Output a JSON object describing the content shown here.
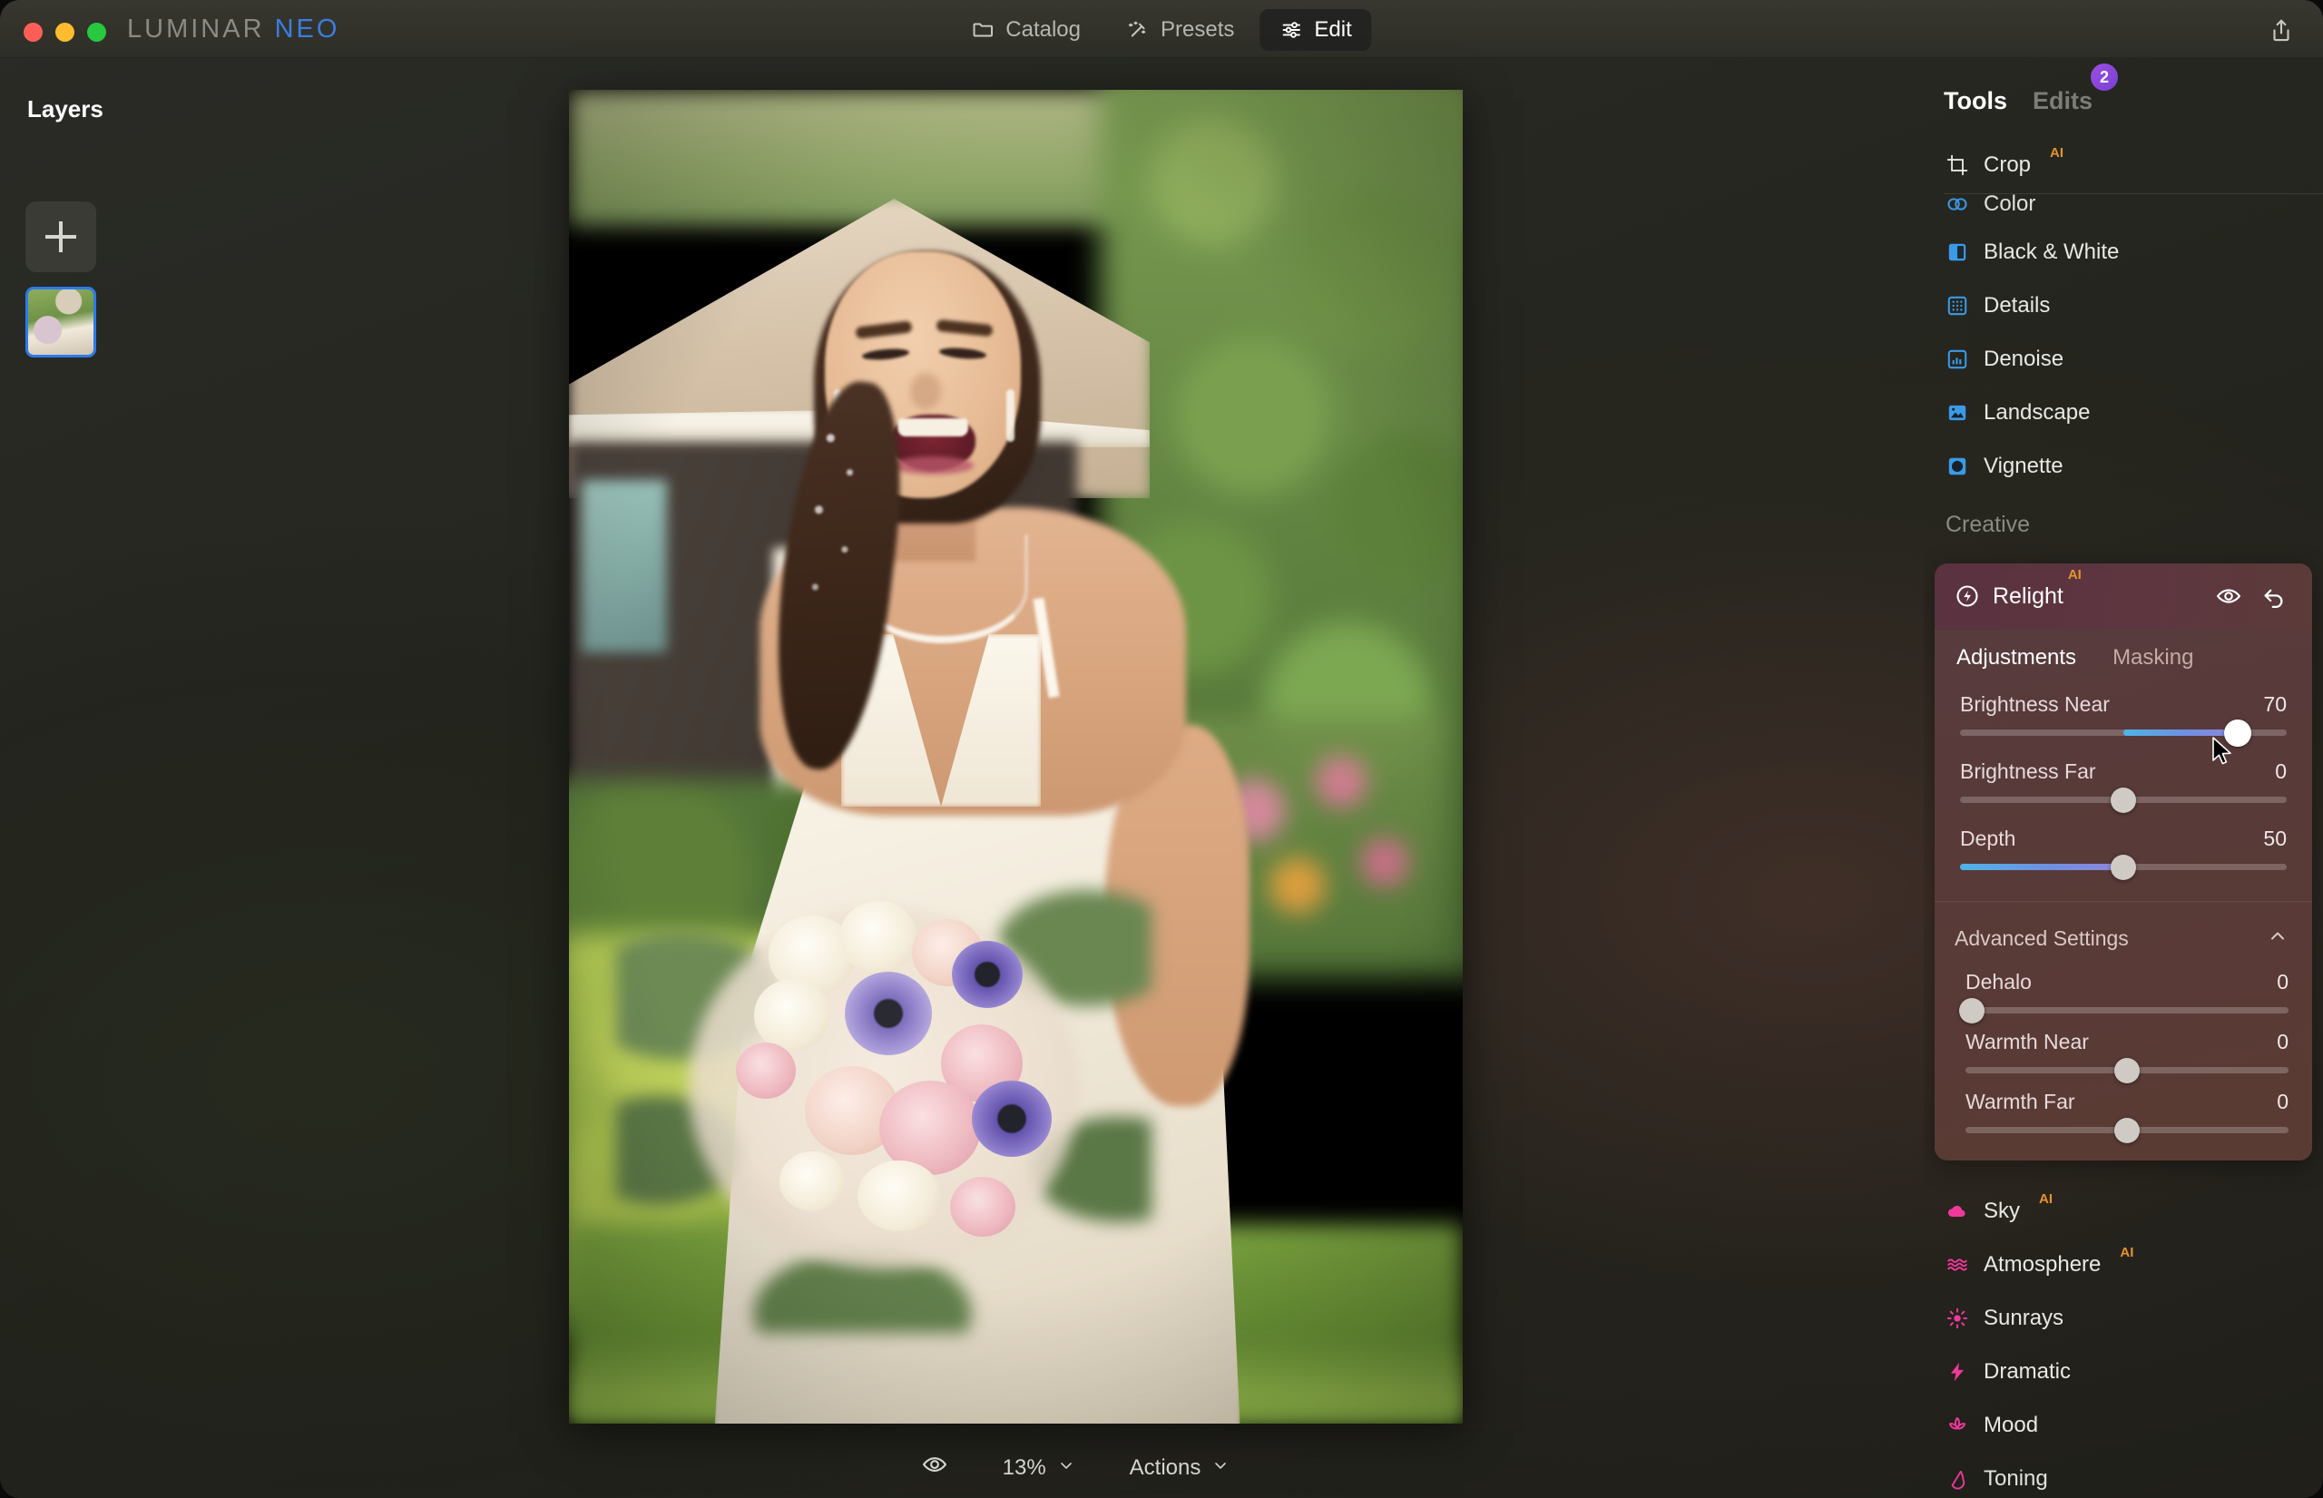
{
  "window": {
    "brand_main": "LUMINAR",
    "brand_accent": "NEO",
    "traffic_lights": [
      "close",
      "minimize",
      "maximize"
    ]
  },
  "topbar": {
    "modes": [
      {
        "label": "Catalog",
        "icon": "folder-icon",
        "active": false
      },
      {
        "label": "Presets",
        "icon": "magic-wand-icon",
        "active": false
      },
      {
        "label": "Edit",
        "icon": "sliders-icon",
        "active": true
      }
    ],
    "export_icon": "share-export-icon"
  },
  "layers": {
    "title": "Layers",
    "add_button_icon": "plus-icon",
    "thumbnail_selected": true,
    "selection_color": "#2b7bea"
  },
  "canvas": {
    "zoom_level": "13%",
    "actions_label": "Actions",
    "preview_icon": "eye-icon",
    "zoom_chevron": "chevron-down-icon",
    "actions_chevron": "chevron-down-icon"
  },
  "tools_panel": {
    "tabs": [
      {
        "label": "Tools",
        "active": true,
        "badge": null
      },
      {
        "label": "Edits",
        "active": false,
        "badge": "2"
      }
    ],
    "essentials": [
      {
        "label": "Crop",
        "icon": "crop-icon",
        "ai": "AI",
        "color": "#e9e9e4"
      }
    ],
    "essentials_scrolled": [
      {
        "label": "Color",
        "icon": "color-icon",
        "ai": null,
        "color": "#3b9ae8"
      },
      {
        "label": "Black & White",
        "icon": "bw-icon",
        "ai": null,
        "color": "#3b9ae8"
      },
      {
        "label": "Details",
        "icon": "details-icon",
        "ai": null,
        "color": "#3b9ae8"
      },
      {
        "label": "Denoise",
        "icon": "denoise-icon",
        "ai": null,
        "color": "#3b9ae8"
      },
      {
        "label": "Landscape",
        "icon": "landscape-icon",
        "ai": null,
        "color": "#3b9ae8"
      },
      {
        "label": "Vignette",
        "icon": "vignette-icon",
        "ai": null,
        "color": "#3b9ae8"
      }
    ],
    "creative_section_label": "Creative",
    "creative": [
      {
        "label": "Sky",
        "icon": "cloud-icon",
        "ai": "AI",
        "color": "#f0399b"
      },
      {
        "label": "Atmosphere",
        "icon": "waves-icon",
        "ai": "AI",
        "color": "#f0399b"
      },
      {
        "label": "Sunrays",
        "icon": "sun-icon",
        "ai": null,
        "color": "#f0399b"
      },
      {
        "label": "Dramatic",
        "icon": "bolt-icon",
        "ai": null,
        "color": "#f0399b"
      },
      {
        "label": "Mood",
        "icon": "lotus-icon",
        "ai": null,
        "color": "#f0399b"
      },
      {
        "label": "Toning",
        "icon": "toning-icon",
        "ai": null,
        "color": "#f0399b"
      }
    ]
  },
  "relight": {
    "title": "Relight",
    "ai_tag": "AI",
    "panel_icon": "relight-bolt-icon",
    "visibility_icon": "eye-icon",
    "reset_icon": "undo-arrow-icon",
    "tabs": [
      {
        "label": "Adjustments",
        "active": true
      },
      {
        "label": "Masking",
        "active": false
      }
    ],
    "sliders": [
      {
        "name": "Brightness Near",
        "value": "70",
        "pct": 85,
        "fill_from": 50,
        "filled": true,
        "active": true
      },
      {
        "name": "Brightness Far",
        "value": "0",
        "pct": 50,
        "fill_from": 50,
        "filled": false,
        "active": false
      },
      {
        "name": "Depth",
        "value": "50",
        "pct": 50,
        "fill_from": 0,
        "filled": true,
        "active": false
      }
    ],
    "advanced": {
      "label": "Advanced Settings",
      "expanded": true,
      "chevron": "chevron-up-icon",
      "sliders": [
        {
          "name": "Dehalo",
          "value": "0",
          "pct": 2,
          "fill_from": 0,
          "filled": false,
          "active": false
        },
        {
          "name": "Warmth Near",
          "value": "0",
          "pct": 50,
          "fill_from": 50,
          "filled": false,
          "active": false
        },
        {
          "name": "Warmth Far",
          "value": "0",
          "pct": 50,
          "fill_from": 50,
          "filled": false,
          "active": false
        }
      ]
    }
  },
  "colors": {
    "accent_blue": "#3b9ae8",
    "accent_pink": "#f0399b",
    "ai_orange": "#e8922c",
    "badge_purple": "#8a45da",
    "relight_panel": "#583b3d",
    "slider_gradient_start": "#4fb4e8",
    "slider_gradient_end": "#8f86dc"
  }
}
